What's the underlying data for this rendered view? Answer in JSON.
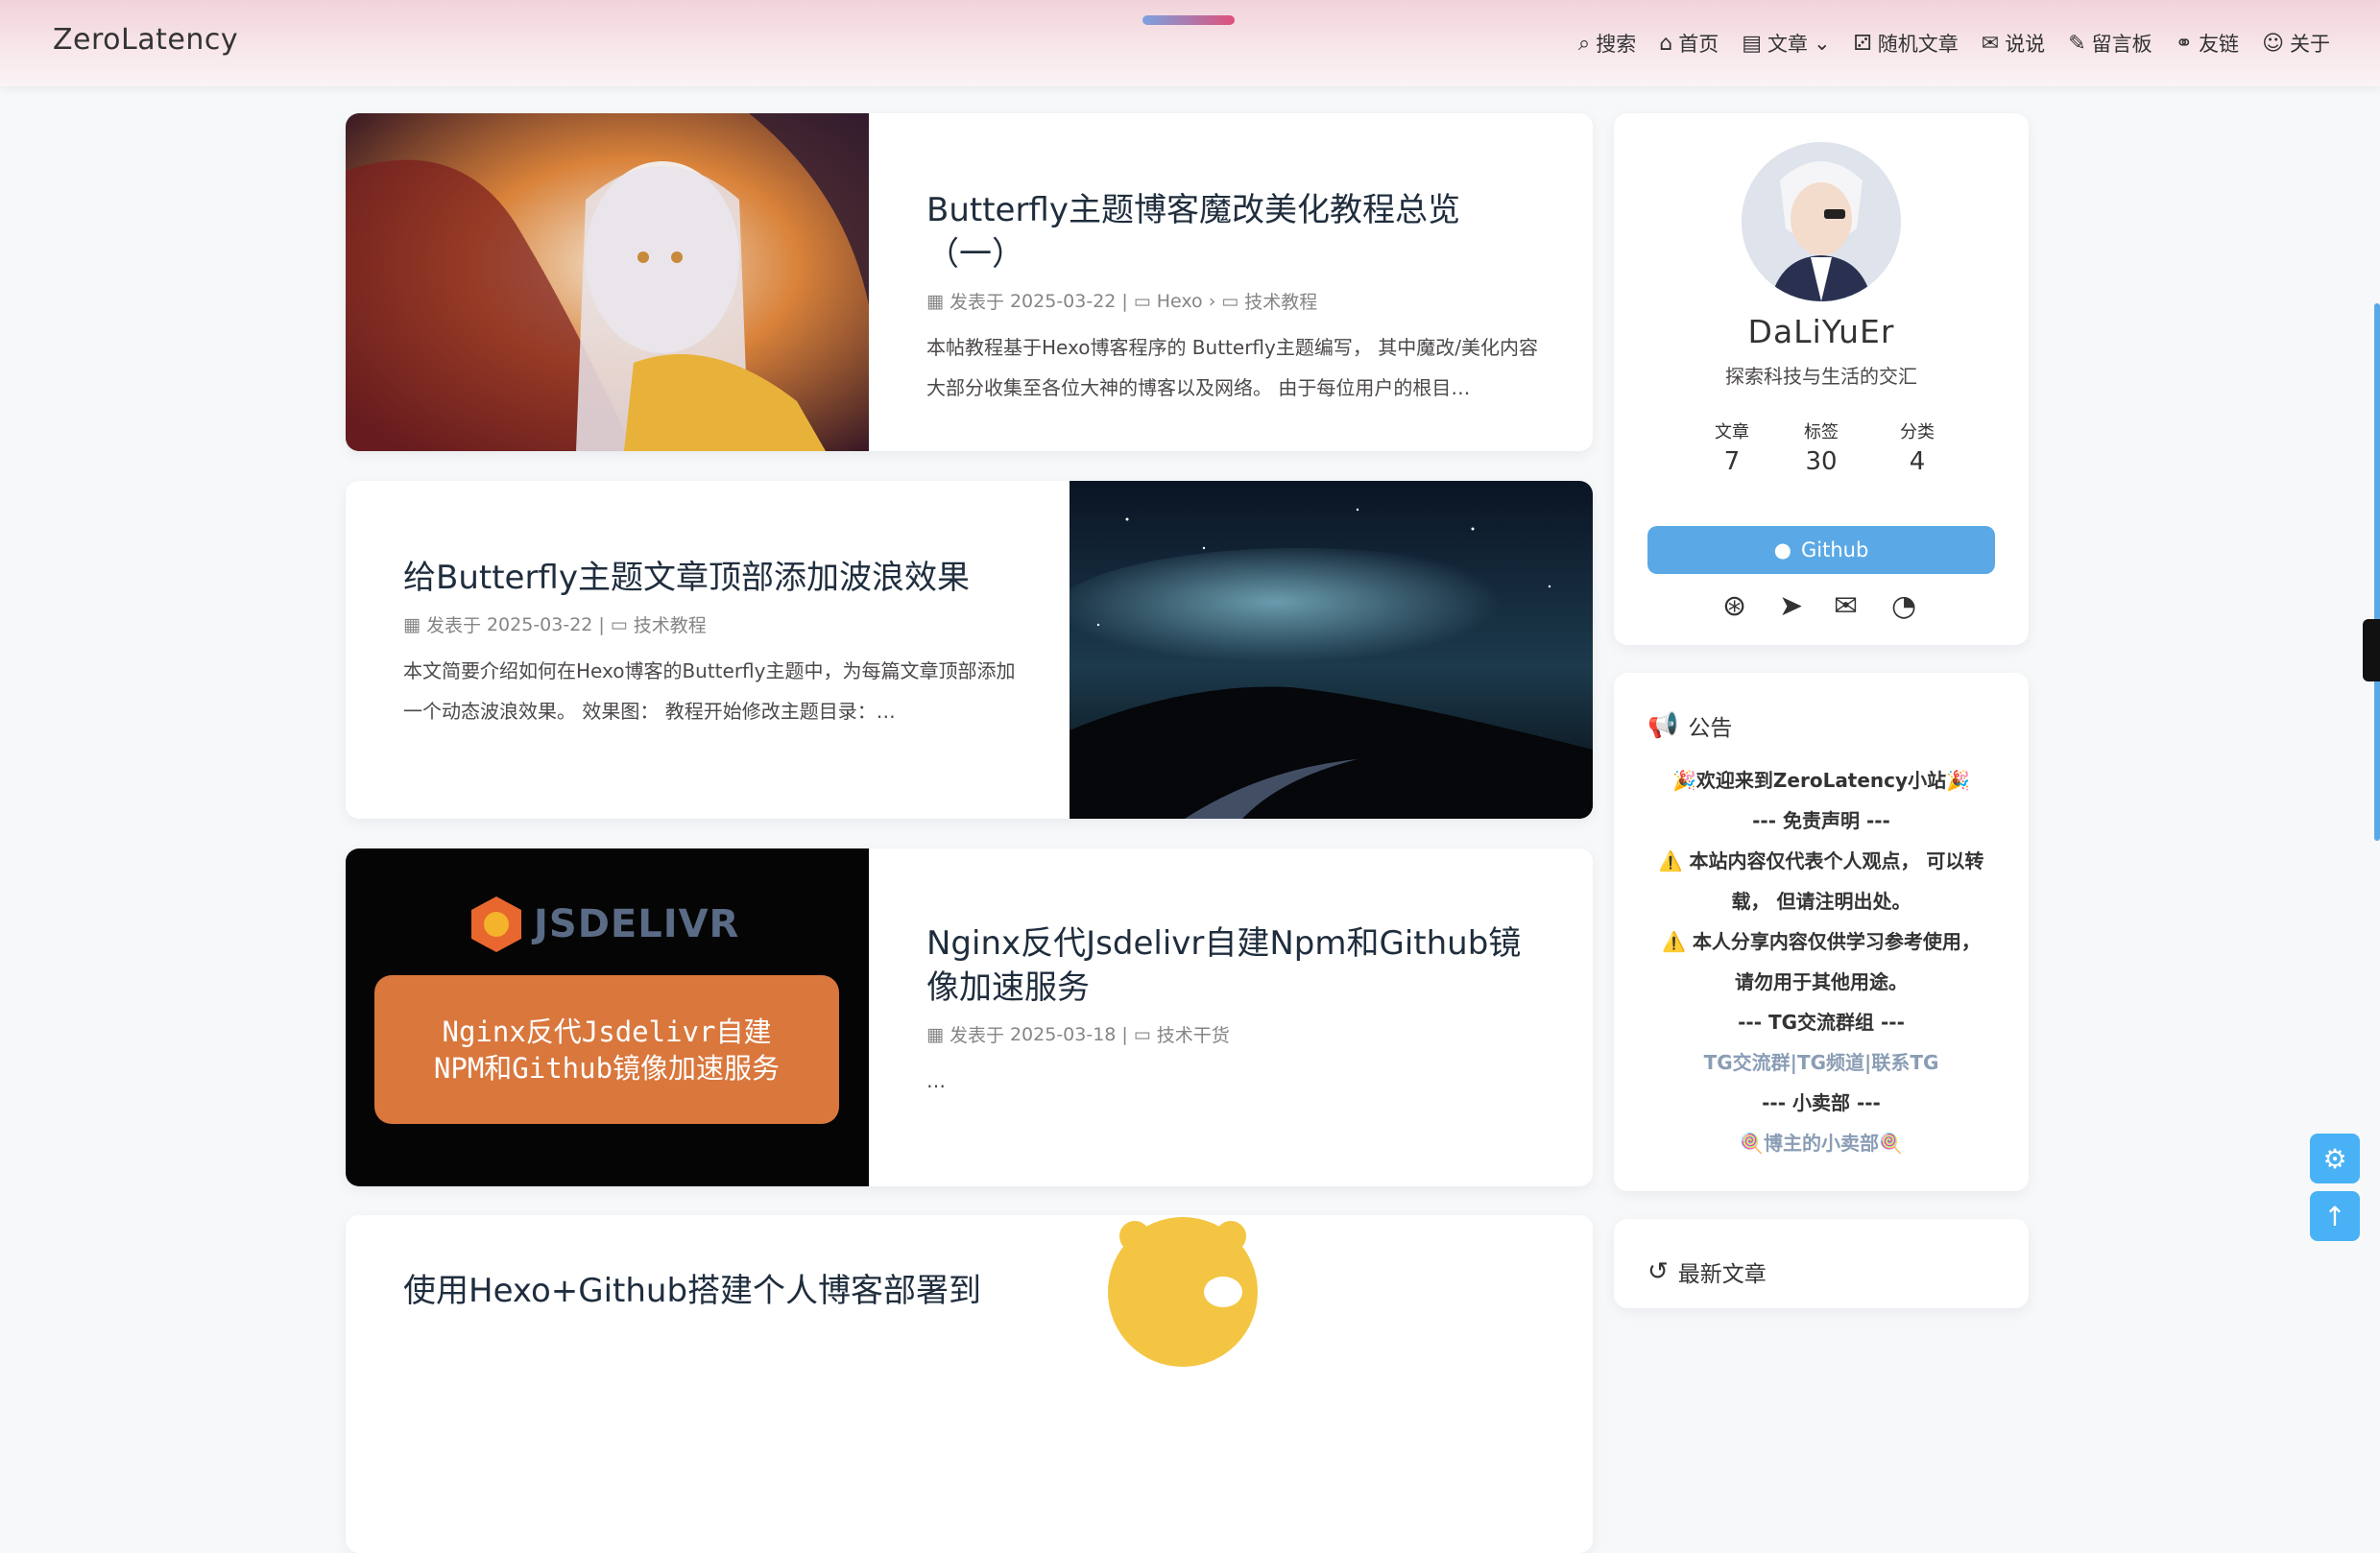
{
  "brand": "ZeroLatency",
  "nav": [
    {
      "icon": "search-icon",
      "glyph": "⌕",
      "label": "搜索"
    },
    {
      "icon": "home-icon",
      "glyph": "⌂",
      "label": "首页"
    },
    {
      "icon": "archive-icon",
      "glyph": "▤",
      "label": "文章",
      "caret": "⌄"
    },
    {
      "icon": "random-icon",
      "glyph": "⚂",
      "label": "随机文章"
    },
    {
      "icon": "comment-icon",
      "glyph": "✉",
      "label": "说说"
    },
    {
      "icon": "edit-icon",
      "glyph": "✎",
      "label": "留言板"
    },
    {
      "icon": "link-icon",
      "glyph": "⚭",
      "label": "友链"
    },
    {
      "icon": "user-icon",
      "glyph": "☺",
      "label": "关于"
    }
  ],
  "posts": [
    {
      "title": "Butterfly主题博客魔改美化教程总览（一）",
      "date_label": "发表于",
      "date": "2025-03-22",
      "categories": [
        "Hexo",
        "技术教程"
      ],
      "excerpt": "本帖教程基于Hexo博客程序的 Butterfly主题编写， 其中魔改/美化内容大部分收集至各位大神的博客以及网络。 由于每位用户的根目…"
    },
    {
      "title": "给Butterfly主题文章顶部添加波浪效果",
      "date_label": "发表于",
      "date": "2025-03-22",
      "categories": [
        "技术教程"
      ],
      "excerpt": "本文简要介绍如何在Hexo博客的Butterfly主题中，为每篇文章顶部添加一个动态波浪效果。 效果图： 教程开始修改主题目录：…"
    },
    {
      "title": "Nginx反代Jsdelivr自建Npm和Github镜像加速服务",
      "date_label": "发表于",
      "date": "2025-03-18",
      "categories": [
        "技术干货"
      ],
      "excerpt": "…",
      "cover_logo": "JSDELIVR",
      "cover_text": "Nginx反代Jsdelivr自建NPM和Github镜像加速服务"
    },
    {
      "title": "使用Hexo+Github搭建个人博客部署到"
    }
  ],
  "profile": {
    "name": "DaLiYuEr",
    "motto": "探索科技与生活的交汇",
    "stats": [
      {
        "label": "文章",
        "value": "7"
      },
      {
        "label": "标签",
        "value": "30"
      },
      {
        "label": "分类",
        "value": "4"
      }
    ],
    "button": "Github",
    "social": [
      "github-icon",
      "telegram-icon",
      "mail-icon",
      "rss-icon"
    ]
  },
  "notice": {
    "title": "公告",
    "lines": [
      "🎉欢迎来到ZeroLatency小站🎉",
      "--- 免责声明 ---",
      "⚠️ 本站内容仅代表个人观点， 可以转",
      "载， 但请注明出处。",
      "⚠️ 本人分享内容仅供学习参考使用，",
      "请勿用于其他用途。",
      "--- TG交流群组 ---",
      "TG交流群|TG频道|联系TG",
      "--- 小卖部 ---",
      "🍭博主的小卖部🍭"
    ]
  },
  "recent": {
    "title": "最新文章"
  },
  "colors": {
    "accent": "#49b1f5",
    "link": "#8a9db5"
  }
}
